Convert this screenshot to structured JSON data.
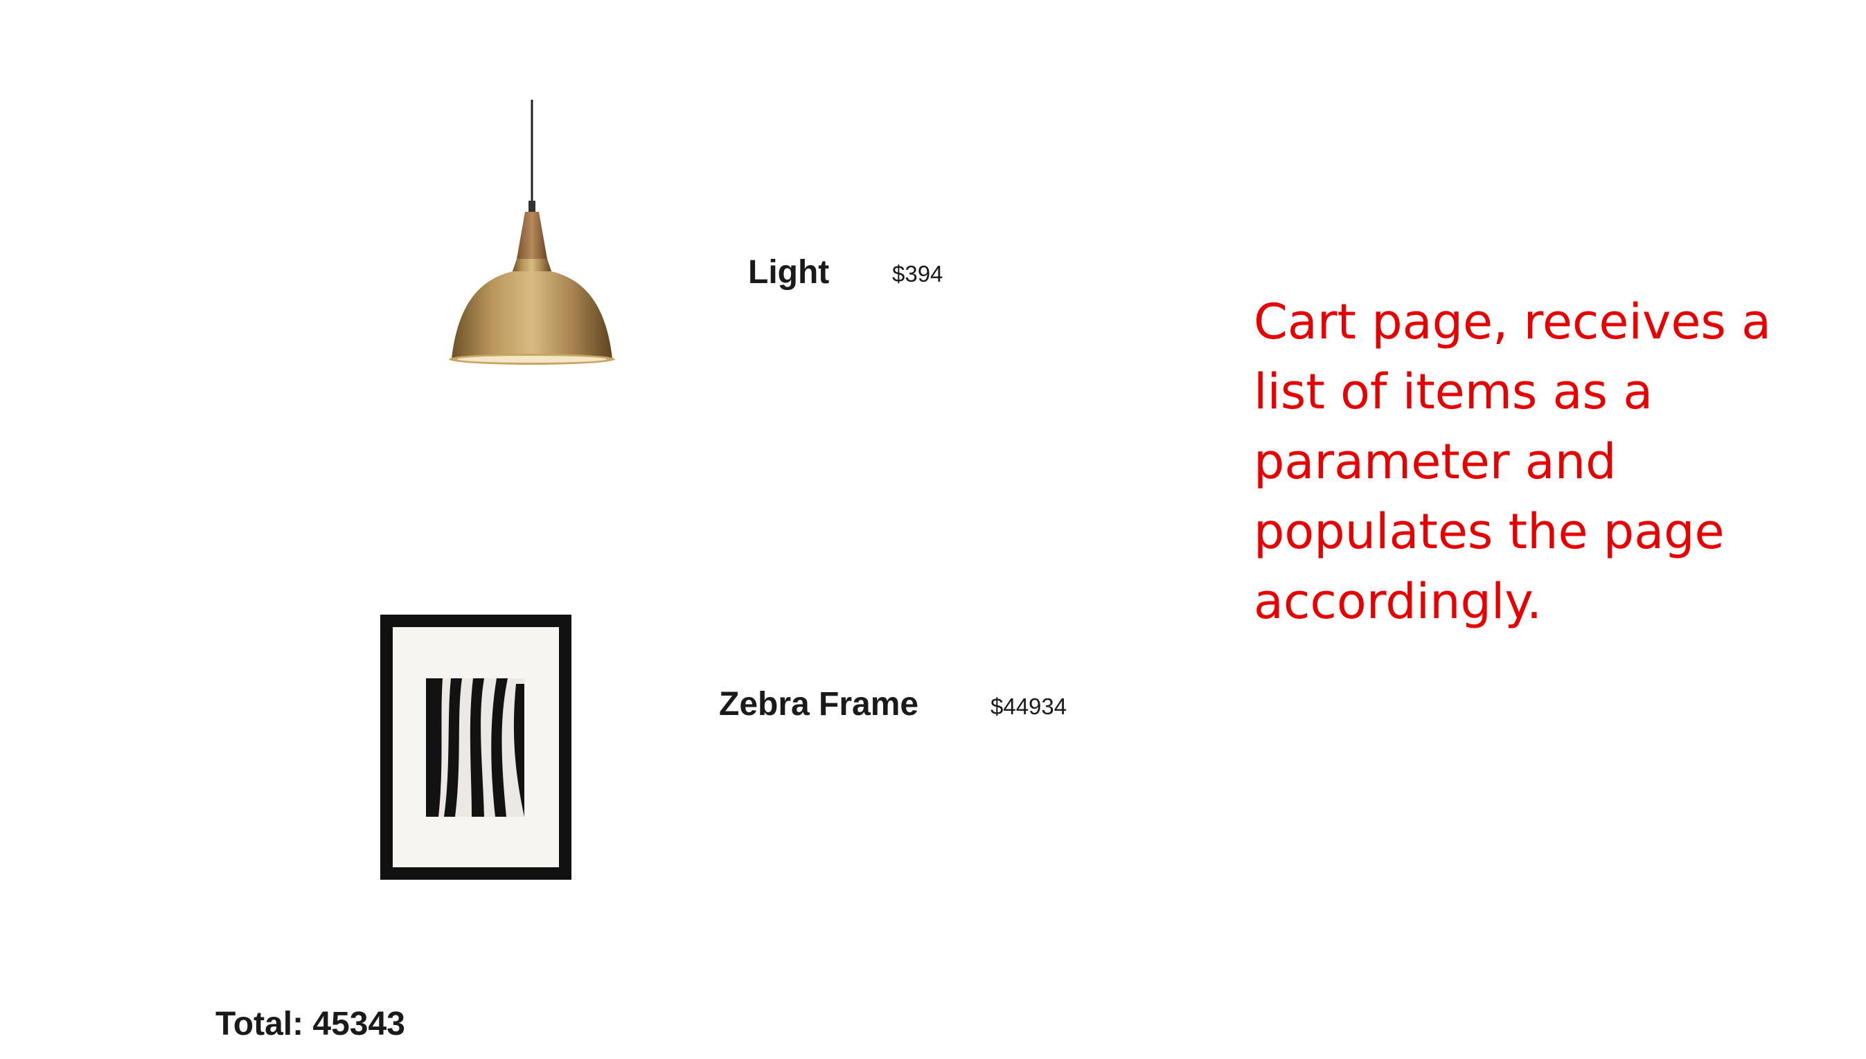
{
  "cart": {
    "items": [
      {
        "name": "Light",
        "price": "$394",
        "icon": "pendant-lamp-icon"
      },
      {
        "name": "Zebra Frame",
        "price": "$44934",
        "icon": "zebra-frame-icon"
      }
    ],
    "total_label": "Total: 45343"
  },
  "annotation": {
    "text": "Cart page, receives a list of items as a parameter and populates the page accordingly.",
    "color": "#e60000"
  },
  "colors": {
    "text": "#1a1a1a",
    "background": "#ffffff",
    "lamp_brass": "#a8834f",
    "frame_black": "#111111"
  }
}
